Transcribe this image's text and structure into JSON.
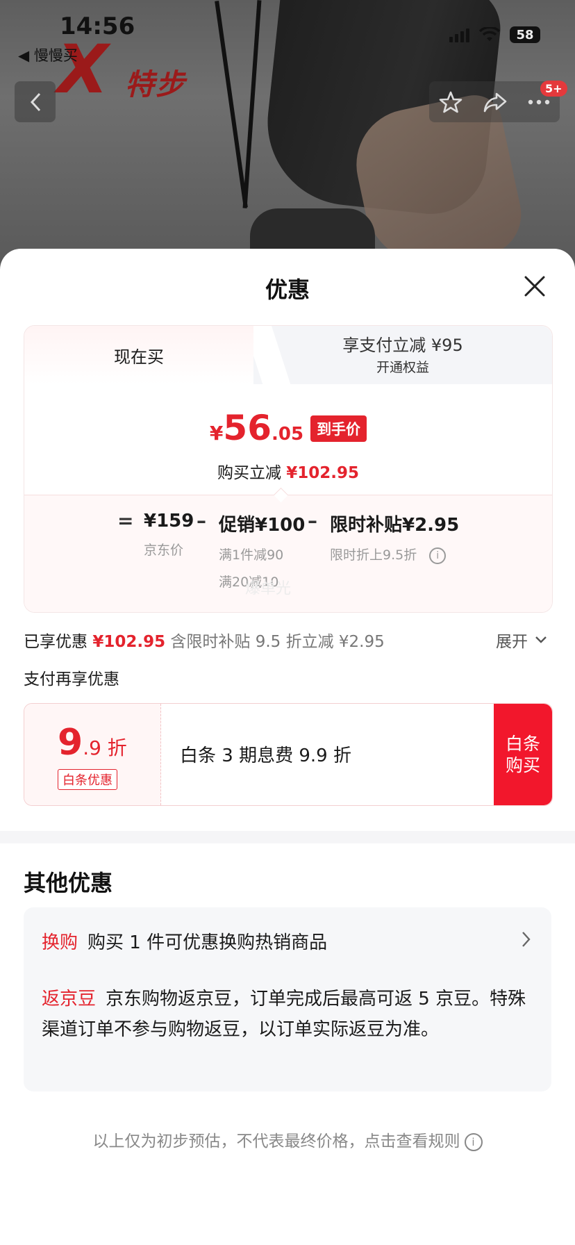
{
  "status_bar": {
    "time": "14:56",
    "back_app": "◀ 慢慢买",
    "battery": "58"
  },
  "background": {
    "brand_x": "X",
    "brand_name": "特步"
  },
  "nav": {
    "cart_badge": "5+"
  },
  "sheet": {
    "title": "优惠"
  },
  "price_card": {
    "tab_now": "现在买",
    "tab_pay_title": "享支付立减 ¥95",
    "tab_pay_sub": "开通权益",
    "price_currency": "¥",
    "price_int": "56",
    "price_dec": ".05",
    "price_tag": "到手价",
    "save_label": "购买立减",
    "save_amount": "¥102.95",
    "eq_op": "=",
    "jd_price": "¥159",
    "jd_price_label": "京东价",
    "minus_op1": "–",
    "promo": "促销¥100",
    "promo_sub1": "满1件减90",
    "promo_sub2": "满20减10",
    "minus_op2": "–",
    "subsidy": "限时补贴¥2.95",
    "subsidy_sub": "限时折上9.5折",
    "watermark": "爆单光"
  },
  "enjoyed": {
    "label": "已享优惠",
    "amount": "¥102.95",
    "note": "含限时补贴 9.5 折立减 ¥2.95",
    "expand": "展开"
  },
  "pay_more": {
    "title": "支付再享优惠"
  },
  "baitiao": {
    "discount_big": "9",
    "discount_small": ".9 折",
    "tag": "白条优惠",
    "text": "白条 3 期息费 9.9 折",
    "buy_line1": "白条",
    "buy_line2": "购买"
  },
  "other": {
    "title": "其他优惠",
    "swap_label": "换购",
    "swap_text": "购买 1 件可优惠换购热销商品",
    "jd_label": "返京豆",
    "jd_text": "京东购物返京豆，订单完成后最高可返 5 京豆。特殊渠道订单不参与购物返豆，以订单实际返豆为准。"
  },
  "disclaimer": "以上仅为初步预估，不代表最终价格，点击查看规则",
  "colors": {
    "accent": "#e4232d",
    "buy_button": "#f2172c"
  }
}
